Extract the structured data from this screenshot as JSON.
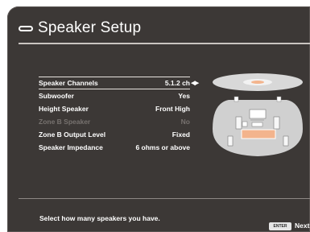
{
  "screen": {
    "title": "Speaker Setup",
    "help_text": "Select how many speakers you have.",
    "enter_label": "ENTER",
    "next_label": "Next"
  },
  "settings": [
    {
      "label": "Speaker Channels",
      "value": "5.1.2 ch",
      "selected": true,
      "enabled": true
    },
    {
      "label": "Subwoofer",
      "value": "Yes",
      "selected": false,
      "enabled": true
    },
    {
      "label": "Height Speaker",
      "value": "Front High",
      "selected": false,
      "enabled": true
    },
    {
      "label": "Zone B Speaker",
      "value": "No",
      "selected": false,
      "enabled": false
    },
    {
      "label": "Zone B Output Level",
      "value": "Fixed",
      "selected": false,
      "enabled": true
    },
    {
      "label": "Speaker Impedance",
      "value": "6 ohms or above",
      "selected": false,
      "enabled": true
    }
  ],
  "icons": {
    "menu": "menu-icon",
    "change_value": "left-right-arrows-icon",
    "illustration": "speaker-layout-illustration"
  },
  "colors": {
    "panel_bg": "#3c3836",
    "text": "#ffffff",
    "disabled_text": "#77726f",
    "rule": "#c9c4c1"
  }
}
